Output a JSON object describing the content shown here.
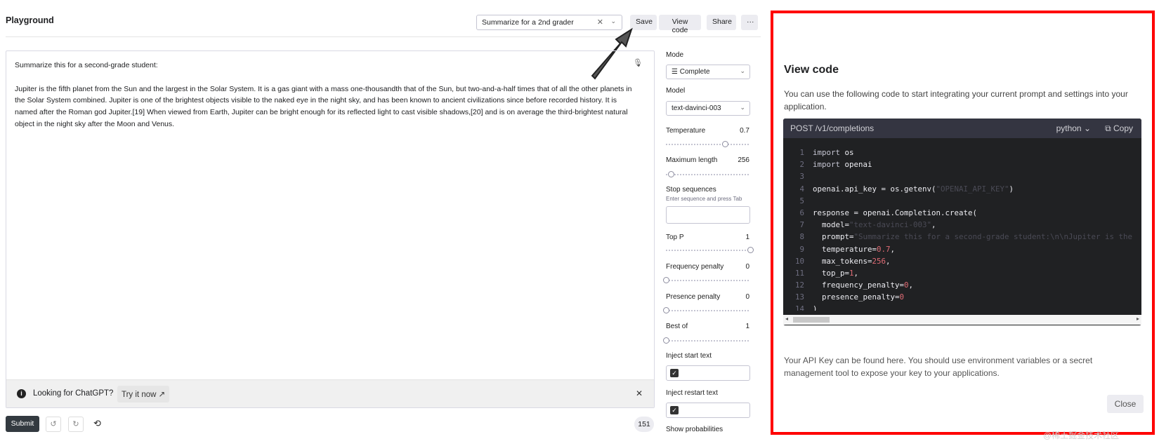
{
  "header": {
    "title": "Playground",
    "preset_value": "Summarize for a 2nd grader",
    "buttons": {
      "save": "Save",
      "view_code": "View code",
      "share": "Share",
      "more": "···"
    }
  },
  "prompt": {
    "text": "Summarize this for a second-grade student:\n\nJupiter is the fifth planet from the Sun and the largest in the Solar System. It is a gas giant with a mass one-thousandth that of the Sun, but two-and-a-half times that of all the other planets in the Solar System combined. Jupiter is one of the brightest objects visible to the naked eye in the night sky, and has been known to ancient civilizations since before recorded history. It is named after the Roman god Jupiter.[19] When viewed from Earth, Jupiter can be bright enough for its reflected light to cast visible shadows,[20] and is on average the third-brightest natural object in the night sky after the Moon and Venus."
  },
  "chatgpt_bar": {
    "text": "Looking for ChatGPT?",
    "link": "Try it now"
  },
  "footer": {
    "submit": "Submit",
    "token_count": "151"
  },
  "settings": {
    "mode_label": "Mode",
    "mode_value": "Complete",
    "model_label": "Model",
    "model_value": "text-davinci-003",
    "temperature_label": "Temperature",
    "temperature_value": "0.7",
    "temperature_level": 0.7,
    "max_length_label": "Maximum length",
    "max_length_value": "256",
    "max_length_level": 0.06,
    "stop_label": "Stop sequences",
    "stop_hint": "Enter sequence and press Tab",
    "top_p_label": "Top P",
    "top_p_value": "1",
    "top_p_level": 1,
    "freq_label": "Frequency penalty",
    "freq_value": "0",
    "freq_level": 0,
    "pres_label": "Presence penalty",
    "pres_value": "0",
    "pres_level": 0,
    "best_of_label": "Best of",
    "best_of_value": "1",
    "best_of_level": 0,
    "inject_start_label": "Inject start text",
    "inject_restart_label": "Inject restart text",
    "show_prob_label": "Show probabilities"
  },
  "view_code": {
    "title": "View code",
    "description": "You can use the following code to start integrating your current prompt and settings into your application.",
    "endpoint": "POST /v1/completions",
    "language": "python ⌄",
    "copy": "Copy",
    "lines": [
      "import os",
      "import openai",
      "",
      "openai.api_key = os.getenv(\"OPENAI_API_KEY\")",
      "",
      "response = openai.Completion.create(",
      "  model=\"text-davinci-003\",",
      "  prompt=\"Summarize this for a second-grade student:\\n\\nJupiter is the",
      "  temperature=0.7,",
      "  max_tokens=256,",
      "  top_p=1,",
      "  frequency_penalty=0,",
      "  presence_penalty=0",
      ")"
    ],
    "footer": "Your API Key can be found here. You should use environment variables or a secret management tool to expose your key to your applications.",
    "close": "Close"
  },
  "watermark": "@稀土掘金技术社区"
}
